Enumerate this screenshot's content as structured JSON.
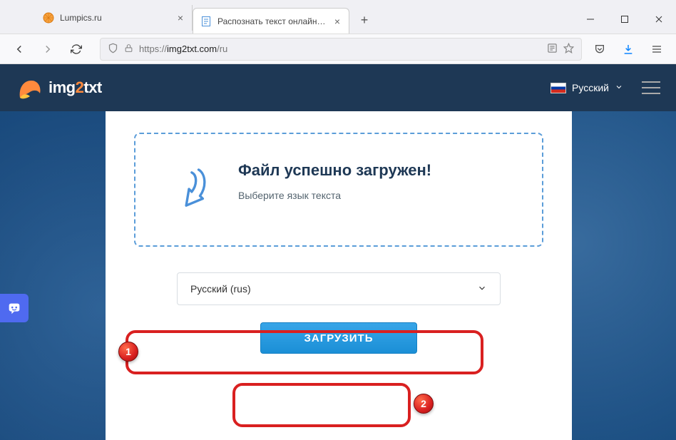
{
  "browser": {
    "tabs": [
      {
        "title": "Lumpics.ru",
        "active": false,
        "favicon": "orange-circle"
      },
      {
        "title": "Распознать текст онлайн с ка",
        "active": true,
        "favicon": "doc"
      }
    ],
    "url_prefix": "https://",
    "url_host": "img2txt.com",
    "url_path": "/ru"
  },
  "header": {
    "brand_1": "img",
    "brand_2": "2",
    "brand_3": "txt",
    "lang_label": "Русский"
  },
  "upload": {
    "title": "Файл успешно загружен!",
    "subtitle": "Выберите язык текста"
  },
  "select": {
    "value": "Русский (rus)"
  },
  "submit": {
    "label": "ЗАГРУЗИТЬ"
  },
  "annotations": {
    "badge1": "1",
    "badge2": "2"
  }
}
